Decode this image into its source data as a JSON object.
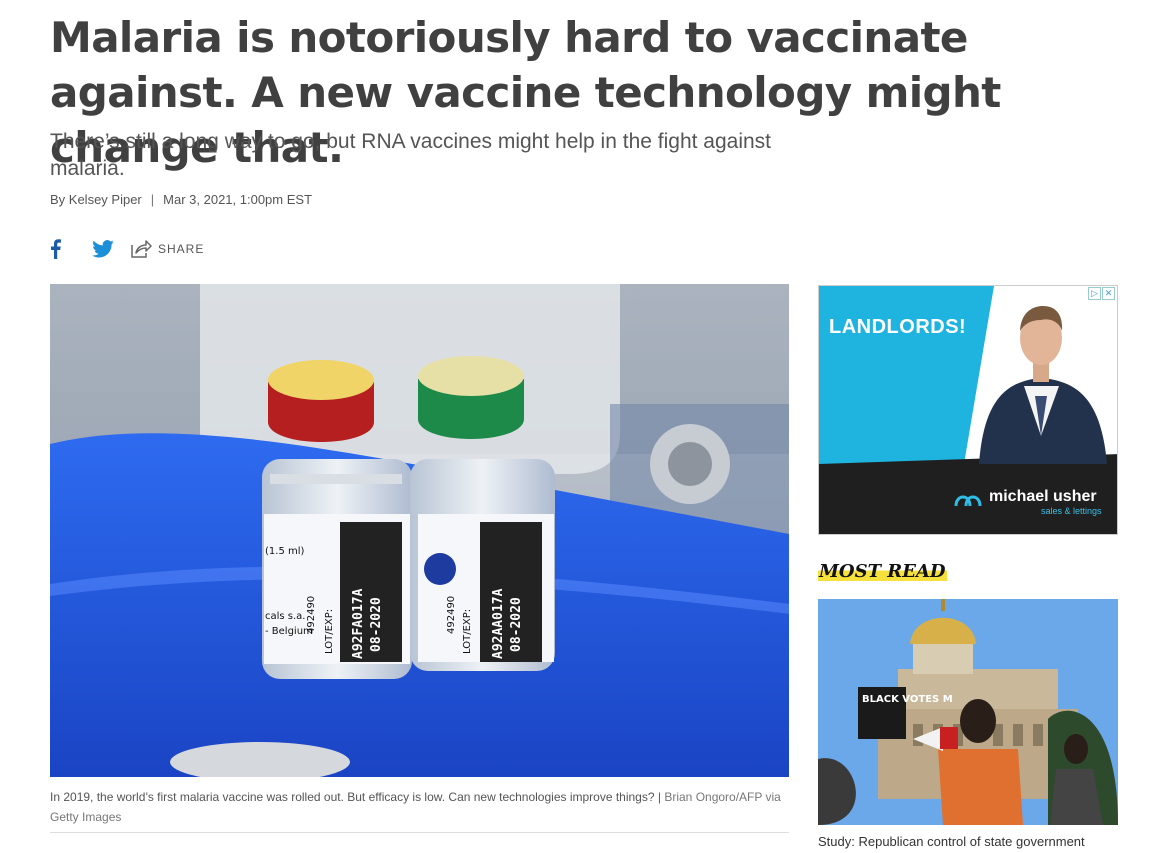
{
  "article": {
    "headline": "Malaria is notoriously hard to vaccinate against. A new vaccine technology might change that.",
    "dek": "There’s still a long way to go, but RNA vaccines might help in the fight against malaria.",
    "author": "By Kelsey Piper",
    "separator": "|",
    "timestamp": "Mar 3, 2021, 1:00pm EST"
  },
  "share": {
    "facebook_icon": "facebook-icon",
    "twitter_icon": "twitter-icon",
    "share_label": "SHARE"
  },
  "hero": {
    "caption": "In 2019, the world’s first malaria vaccine was rolled out. But efficacy is low. Can new technologies improve things?",
    "caption_sep": "|",
    "credit": "Brian Ongoro/AFP via Getty Images",
    "vial_left": {
      "line1": "A92FA017A",
      "line2": "08-2020",
      "lot_label": "LOT/EXP:",
      "num": "492490",
      "dose": "(1.5 ml)",
      "mfr": "cals s.a.",
      "country": "- Belgium"
    },
    "vial_right": {
      "line1": "A92AA017A",
      "line2": "08-2020",
      "lot_label": "LOT/EXP:",
      "num": "492490"
    }
  },
  "ad": {
    "badge_icons": [
      "ad-choices-icon",
      "close-icon"
    ],
    "headline": "LANDLORDS!",
    "brand": "michael usher",
    "tagline": "sales & lettings",
    "colors": {
      "cyan": "#1fb3e0",
      "dark": "#1f1f1f"
    }
  },
  "sidebar": {
    "most_read_label": "MOST READ",
    "highlight_color": "#f5e03c",
    "thumb_sign_text": "BLACK VOTES M",
    "first_item_title": "Study: Republican control of state government"
  }
}
